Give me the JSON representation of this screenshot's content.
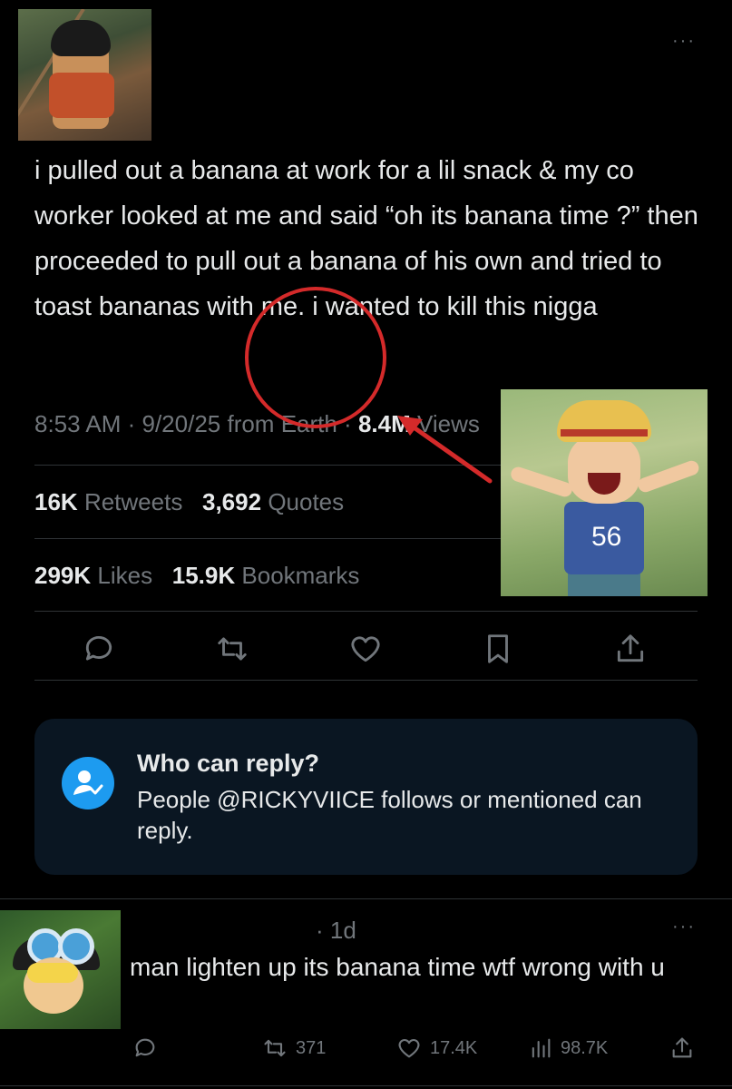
{
  "tweet": {
    "more": "···",
    "text": "i pulled out a banana at work for a lil snack & my co worker looked at me and said “oh its banana time ?” then proceeded to pull out a banana of his own and tried to toast bananas with me. i wanted to kill this nigga",
    "meta_prefix": "8:53 AM · 9/20/25 from Earth · ",
    "views_count": "8.4M",
    "views_label": " Views",
    "retweets_count": "16K",
    "retweets_label": "Retweets",
    "quotes_count": "3,692",
    "quotes_label": "Quotes",
    "likes_count": "299K",
    "likes_label": "Likes",
    "bookmarks_count": "15.9K",
    "bookmarks_label": "Bookmarks",
    "icons": [
      "reply-icon",
      "retweet-icon",
      "like-icon",
      "bookmark-icon",
      "share-icon"
    ]
  },
  "who_can_reply": {
    "title": "Who can reply?",
    "description": "People @RICKYVIICE follows or mentioned can reply."
  },
  "reply": {
    "time": "· 1d",
    "more": "···",
    "text": "man lighten up its banana time wtf wrong with u",
    "retweets": "371",
    "likes": "17.4K",
    "views": "98.7K"
  },
  "overlay": {
    "jersey_number": "56"
  },
  "colors": {
    "background": "#000000",
    "text": "#e7e9ea",
    "muted": "#71767b",
    "accent": "#1d9bf0",
    "annotation": "#d42a2a"
  }
}
